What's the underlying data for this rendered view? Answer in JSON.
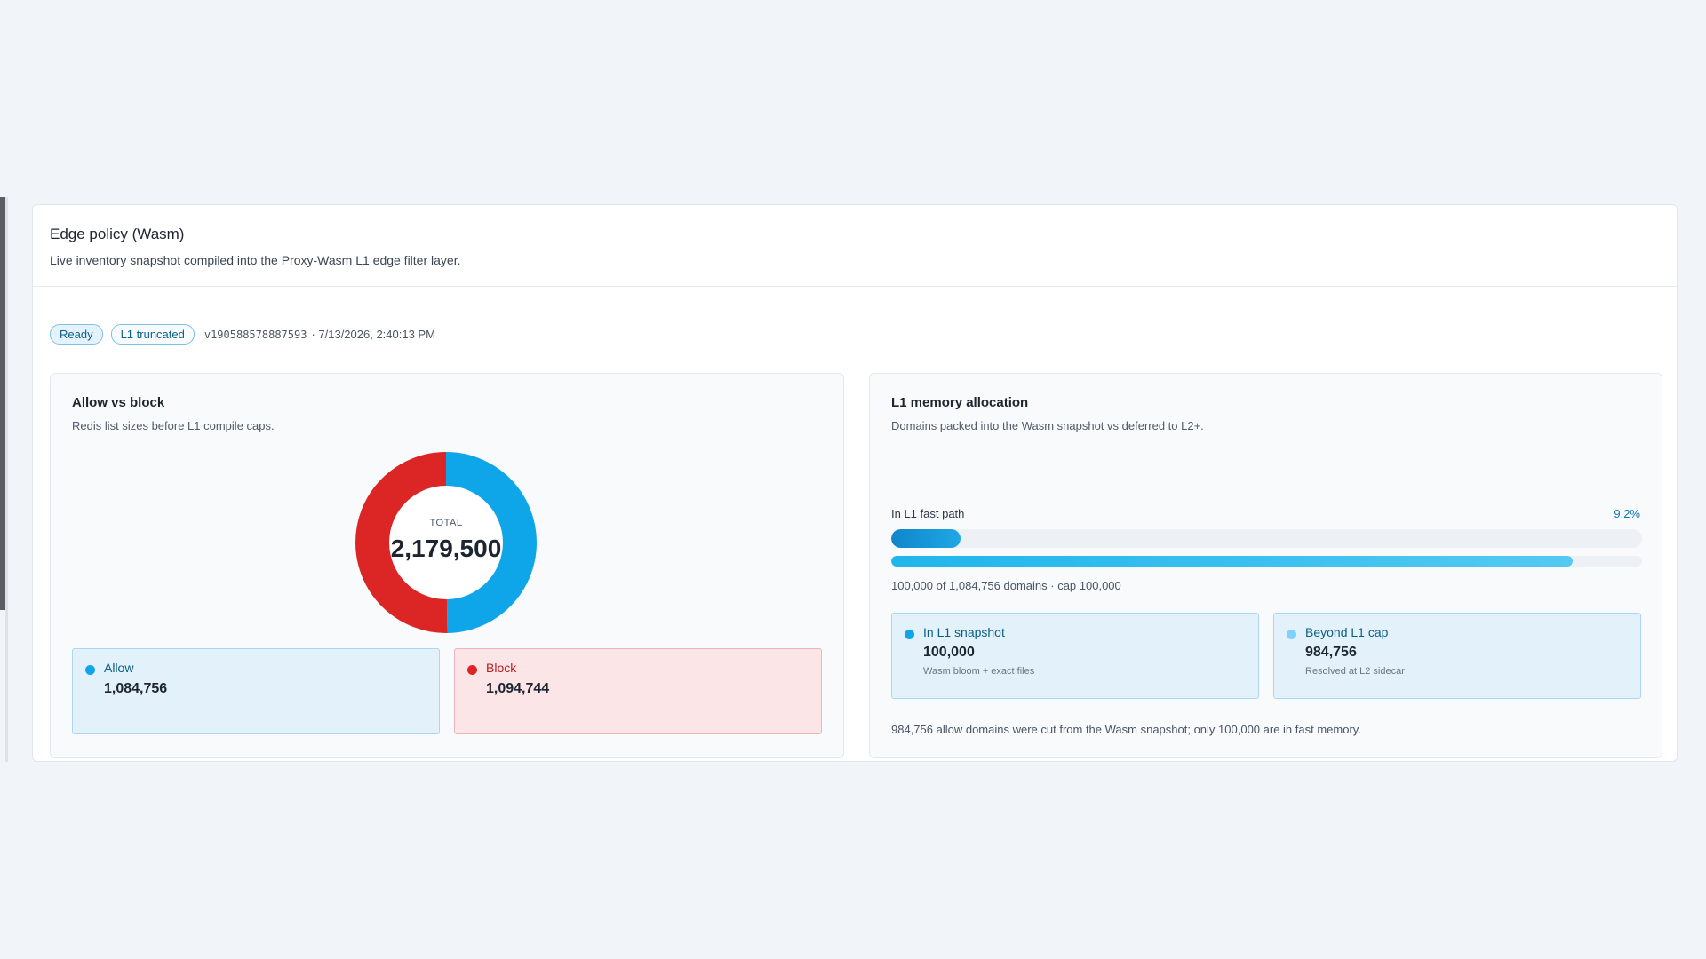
{
  "card": {
    "title": "Edge policy (Wasm)",
    "subtitle": "Live inventory snapshot compiled into the Proxy-Wasm L1 edge filter layer."
  },
  "meta": {
    "status_badge": "Ready",
    "truncated_badge": "L1 truncated",
    "version": "v190588578887593",
    "timestamp": "· 7/13/2026, 2:40:13 PM"
  },
  "allow_block": {
    "title": "Allow vs block",
    "subtitle": "Redis list sizes before L1 compile caps.",
    "total_label": "TOTAL",
    "total_value": "2,179,500",
    "allow": {
      "label": "Allow",
      "value": "1,084,756",
      "color": "#0ea5e9"
    },
    "block": {
      "label": "Block",
      "value": "1,094,744",
      "color": "#dc2626"
    }
  },
  "chart_data": {
    "type": "pie",
    "categories": [
      "Allow",
      "Block"
    ],
    "values": [
      1084756,
      1094744
    ],
    "colors": [
      "#0ea5e9",
      "#dc2626"
    ],
    "title": "Allow vs block",
    "center_label": "TOTAL",
    "center_value": 2179500
  },
  "memory": {
    "title": "L1 memory allocation",
    "subtitle": "Domains packed into the Wasm snapshot vs deferred to L2+.",
    "bar_label": "In L1 fast path",
    "bar_percent": "9.2%",
    "bar_fraction": 0.092,
    "secondary_fraction": 0.908,
    "caption": "100,000 of 1,084,756 domains · cap 100,000",
    "in_l1": {
      "label": "In L1 snapshot",
      "value": "100,000",
      "note": "Wasm bloom + exact files",
      "color": "#0ea5e9"
    },
    "beyond": {
      "label": "Beyond L1 cap",
      "value": "984,756",
      "note": "Resolved at L2 sidecar",
      "color": "#7dd3fc"
    },
    "footnote": "984,756 allow domains were cut from the Wasm snapshot; only 100,000 are in fast memory."
  }
}
